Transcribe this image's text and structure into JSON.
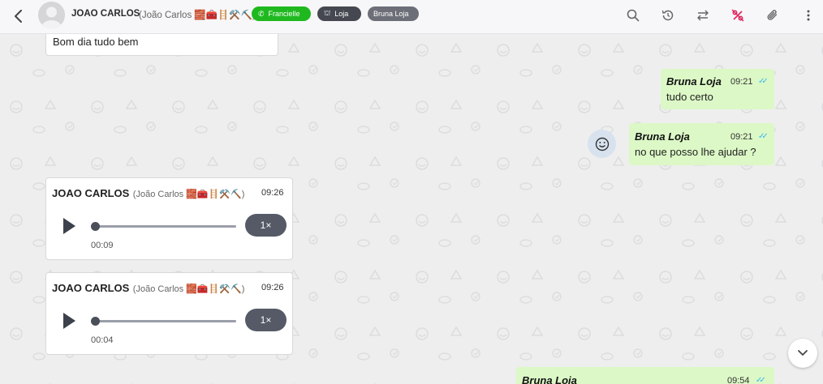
{
  "header": {
    "contact_name": "JOAO CARLOS",
    "contact_subtitle": "(João Carlos 🧱🧰🪜⚒️⛏️)",
    "tags": [
      {
        "label": "Francielle",
        "icon": "whatsapp-icon",
        "color": "#1fb91f"
      },
      {
        "label": "Loja",
        "icon": "store-icon",
        "color": "#454850"
      },
      {
        "label": "Bruna Loja",
        "color": "#6c6f78"
      }
    ],
    "actions": [
      "search-icon",
      "history-icon",
      "transfer-icon",
      "no-discount-icon",
      "attach-icon",
      "more-icon"
    ]
  },
  "messages": [
    {
      "type": "text",
      "direction": "in",
      "text": "Bom dia tudo bem"
    },
    {
      "type": "text",
      "direction": "out",
      "sender": "Bruna Loja",
      "time": "09:21",
      "text": "tudo certo",
      "ticks": "✓✓"
    },
    {
      "type": "text",
      "direction": "out",
      "sender": "Bruna Loja",
      "time": "09:21",
      "text": "no que posso lhe ajudar ?",
      "ticks": "✓✓"
    },
    {
      "type": "audio",
      "direction": "in",
      "sender": "JOAO CARLOS",
      "sender_sub": "(João Carlos 🧱🧰🪜⚒️⛏️)",
      "time": "09:26",
      "speed": "1×",
      "duration": "00:09"
    },
    {
      "type": "audio",
      "direction": "in",
      "sender": "JOAO CARLOS",
      "sender_sub": "(João Carlos 🧱🧰🪜⚒️⛏️)",
      "time": "09:26",
      "speed": "1×",
      "duration": "00:04"
    },
    {
      "type": "text",
      "direction": "out",
      "sender": "Bruna Loja",
      "time": "09:54",
      "ticks": "✓✓"
    }
  ],
  "colors": {
    "outgoing_bubble": "#dcf8c6",
    "incoming_bubble": "#ffffff",
    "read_ticks": "#34b7f1",
    "accent_red": "#e0245e"
  }
}
